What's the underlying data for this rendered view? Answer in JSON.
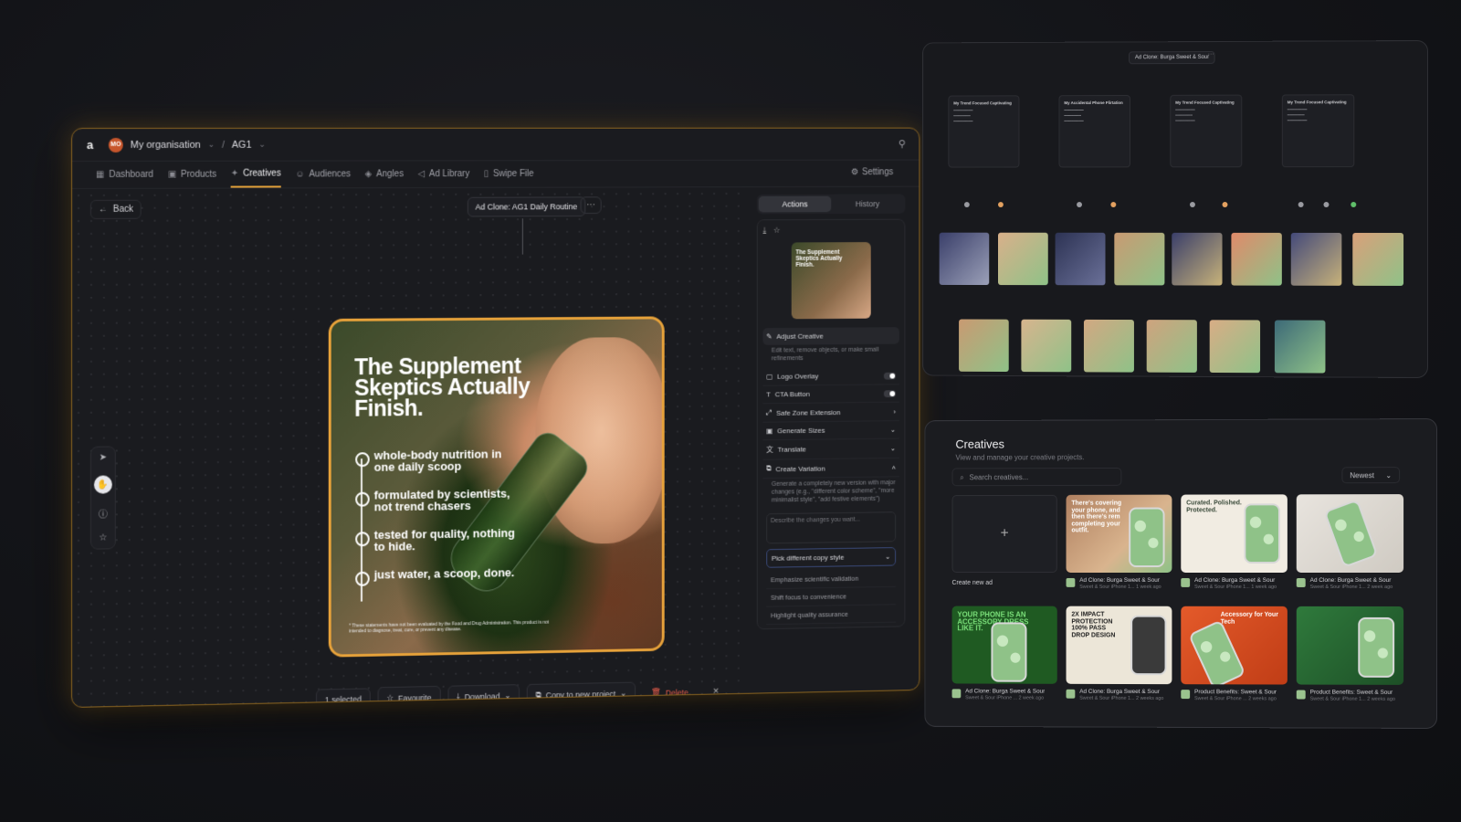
{
  "main": {
    "topbar": {
      "org_initials": "MO",
      "org_name": "My organisation",
      "separator": "/",
      "project": "AG1"
    },
    "nav": [
      {
        "label": "Dashboard",
        "icon": "grid-icon"
      },
      {
        "label": "Products",
        "icon": "box-icon"
      },
      {
        "label": "Creatives",
        "icon": "sparkle-icon",
        "active": true
      },
      {
        "label": "Audiences",
        "icon": "users-icon"
      },
      {
        "label": "Angles",
        "icon": "layers-icon"
      },
      {
        "label": "Ad Library",
        "icon": "megaphone-icon"
      },
      {
        "label": "Swipe File",
        "icon": "bookmark-icon"
      }
    ],
    "settings_label": "Settings",
    "back_label": "Back",
    "canvas_title": "Ad Clone: AG1 Daily Routine",
    "ad": {
      "headline": "The Supplement Skeptics Actually Finish.",
      "bullets": [
        "whole-body nutrition in one daily scoop",
        "formulated by scientists, not trend chasers",
        "tested for quality, nothing to hide.",
        "just water, a scoop, done."
      ],
      "disclaimer": "* These statements have not been evaluated by the Food and Drug Administration. This product is not intended to diagnose, treat, cure, or prevent any disease."
    },
    "selection_bar": {
      "selected": "1 selected",
      "favourite": "Favourite",
      "download": "Download",
      "copy": "Copy to new project",
      "delete": "Delete"
    },
    "side_panel": {
      "tabs": [
        "Actions",
        "History"
      ],
      "thumb_text": "The Supplement Skeptics Actually Finish.",
      "adjust_title": "Adjust Creative",
      "adjust_desc": "Edit text, remove objects, or make small refinements",
      "logo_overlay": "Logo Overlay",
      "cta_button": "CTA Button",
      "safe_zone": "Safe Zone Extension",
      "generate_sizes": "Generate Sizes",
      "translate": "Translate",
      "create_variation": "Create Variation",
      "variation_desc": "Generate a completely new version with major changes (e.g., \"different color scheme\", \"more minimalist style\", \"add festive elements\")",
      "describe_placeholder": "Describe the changes you want...",
      "pick_style": "Pick different copy style",
      "options": [
        "Emphasize scientific validation",
        "Shift focus to convenience",
        "Highlight quality assurance"
      ]
    }
  },
  "graph": {
    "title": "Ad Clone: Burga Sweet & Sour",
    "nodes": [
      {
        "title": "My Trend Focused Captivating"
      },
      {
        "title": "My Accidental Phone Flirtation"
      },
      {
        "title": "My Trend Focused Captivating"
      },
      {
        "title": "My Trend Focused Captivating"
      }
    ]
  },
  "creatives": {
    "title": "Creatives",
    "subtitle": "View and manage your creative projects.",
    "search_placeholder": "Search creatives...",
    "sort": "Newest",
    "new_ad_label": "Create new ad",
    "cards": [
      {
        "name": "Ad Clone: Burga Sweet & Sour",
        "desc": "Sweet & Sour iPhone 1... 1 week ago",
        "text": "There's covering your phone, and then there's rem completing your outfit."
      },
      {
        "name": "Ad Clone: Burga Sweet & Sour",
        "desc": "Sweet & Sour iPhone 1... 1 week ago",
        "text": "Curated. Polished. Protected."
      },
      {
        "name": "Ad Clone: Burga Sweet & Sour",
        "desc": "Sweet & Sour iPhone 1... 2 week ago",
        "text": ""
      },
      {
        "name": "Ad Clone: Burga Sweet & Sour",
        "desc": "Sweet & Sour iPhone ... 2 week ago",
        "text": "YOUR PHONE IS AN ACCESSORY DRESS LIKE IT."
      },
      {
        "name": "Ad Clone: Burga Sweet & Sour",
        "desc": "Sweet & Sour iPhone 1... 2 weeks ago",
        "text": "2X IMPACT PROTECTION 100% PASS DROP DESIGN"
      },
      {
        "name": "Product Benefits: Sweet & Sour",
        "desc": "Sweet & Sour iPhone ... 2 weeks ago",
        "text": "Accessory for Your Tech"
      },
      {
        "name": "Product Benefits: Sweet & Sour",
        "desc": "Sweet & Sour iPhone 1... 2 weeks ago",
        "text": ""
      }
    ]
  }
}
